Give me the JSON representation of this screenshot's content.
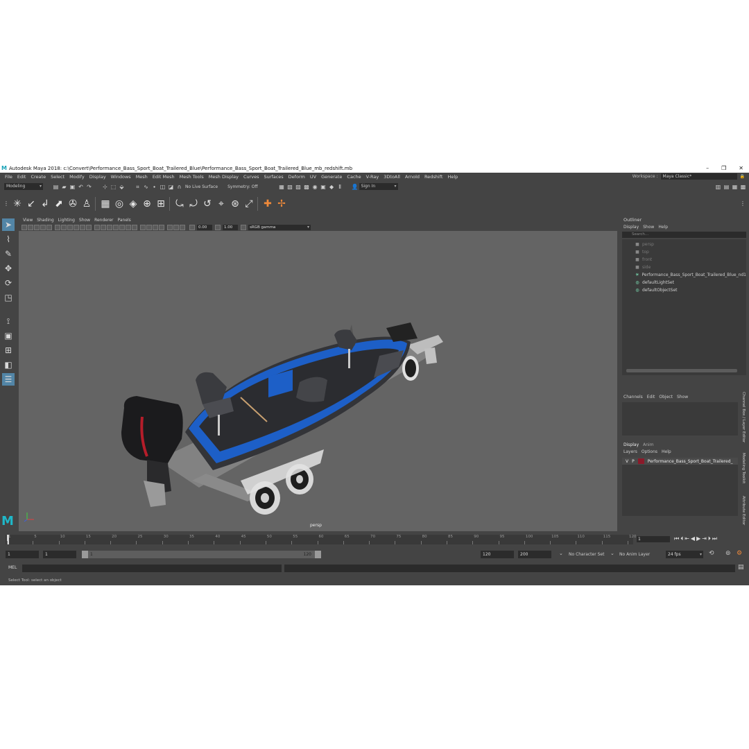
{
  "window": {
    "title": "Autodesk Maya 2018: c:\\Convert\\Performance_Bass_Sport_Boat_Trailered_Blue\\Performance_Bass_Sport_Boat_Trailered_Blue_mb_redshift.mb"
  },
  "menu": [
    "File",
    "Edit",
    "Create",
    "Select",
    "Modify",
    "Display",
    "Windows",
    "Mesh",
    "Edit Mesh",
    "Mesh Tools",
    "Mesh Display",
    "Curves",
    "Surfaces",
    "Deform",
    "UV",
    "Generate",
    "Cache",
    "V-Ray",
    "3DtoAll",
    "Arnold",
    "Redshift",
    "Help"
  ],
  "workspace": {
    "label": "Workspace :",
    "value": "Maya Classic*"
  },
  "status": {
    "mode": "Modeling",
    "live_surface": "No Live Surface",
    "symmetry": "Symmetry: Off",
    "sign_in": "Sign In"
  },
  "viewport": {
    "menu": [
      "View",
      "Shading",
      "Lighting",
      "Show",
      "Renderer",
      "Panels"
    ],
    "exposure": "0.00",
    "gamma": "1.00",
    "color_space": "sRGB gamma",
    "camera": "persp"
  },
  "outliner": {
    "title": "Outliner",
    "menu": [
      "Display",
      "Show",
      "Help"
    ],
    "search_placeholder": "Search...",
    "items": [
      {
        "label": "persp",
        "dim": true
      },
      {
        "label": "top",
        "dim": true
      },
      {
        "label": "front",
        "dim": true
      },
      {
        "label": "side",
        "dim": true
      },
      {
        "label": "Performance_Bass_Sport_Boat_Trailered_Blue_nd1",
        "dim": false
      },
      {
        "label": "defaultLightSet",
        "dim": false
      },
      {
        "label": "defaultObjectSet",
        "dim": false
      }
    ]
  },
  "channels": {
    "menu": [
      "Channels",
      "Edit",
      "Object",
      "Show"
    ]
  },
  "layers": {
    "tabs": [
      "Display",
      "Anim"
    ],
    "menu": [
      "Layers",
      "Options",
      "Help"
    ],
    "row": {
      "v": "V",
      "p": "P",
      "name": "Performance_Bass_Sport_Boat_Trailered_",
      "color": "#8a1a2a"
    }
  },
  "side_tabs": [
    "Channel Box / Layer Editor",
    "Modeling Toolkit",
    "Attribute Editor"
  ],
  "timeline": {
    "ticks": [
      "1",
      "5",
      "10",
      "15",
      "20",
      "25",
      "30",
      "35",
      "40",
      "45",
      "50",
      "55",
      "60",
      "65",
      "70",
      "75",
      "80",
      "85",
      "90",
      "95",
      "100",
      "105",
      "110",
      "115",
      "120"
    ],
    "current_frame": "1"
  },
  "range": {
    "start": "1",
    "playback_start": "1",
    "bar_start": "1",
    "bar_end": "120",
    "playback_end": "120",
    "end": "200",
    "character": "No Character Set",
    "anim_layer": "No Anim Layer",
    "fps": "24 fps"
  },
  "command": {
    "lang": "MEL"
  },
  "help_line": "Select Tool: select an object"
}
